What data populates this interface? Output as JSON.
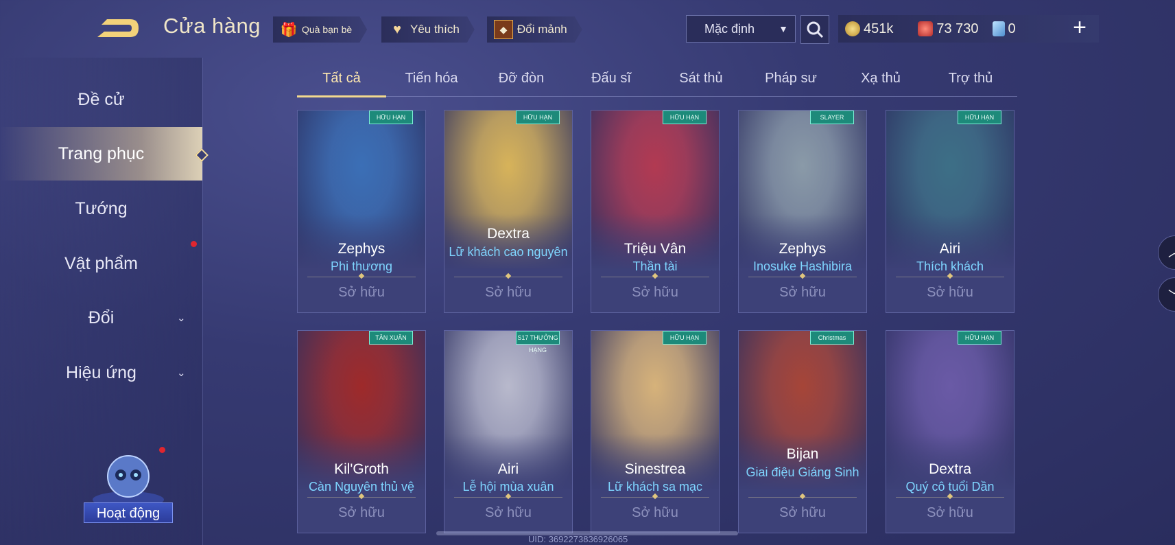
{
  "header": {
    "title": "Cửa hàng",
    "gift_label": "Quà bạn bè",
    "favorite_label": "Yêu thích",
    "exchange_label": "Đổi mảnh",
    "sort_label": "Mặc định",
    "gold": "451k",
    "voucher": "73 730",
    "gems": "0"
  },
  "sidebar": {
    "items": [
      {
        "label": "Đề cử"
      },
      {
        "label": "Trang phục"
      },
      {
        "label": "Tướng"
      },
      {
        "label": "Vật phẩm"
      },
      {
        "label": "Đổi"
      },
      {
        "label": "Hiệu ứng"
      }
    ],
    "activity_label": "Hoạt động"
  },
  "tabs": [
    "Tất cả",
    "Tiến hóa",
    "Đỡ đòn",
    "Đấu sĩ",
    "Sát thủ",
    "Pháp sư",
    "Xạ thủ",
    "Trợ thủ"
  ],
  "cards": [
    {
      "hero": "Zephys",
      "skin": "Phi thương",
      "status": "Sở hữu",
      "badge": "HỮU HẠN",
      "color": "#3b6fb6"
    },
    {
      "hero": "Dextra",
      "skin": "Lữ khách cao nguyên",
      "status": "Sở hữu",
      "badge": "HỮU HẠN",
      "color": "#d7b35a"
    },
    {
      "hero": "Triệu Vân",
      "skin": "Thần tài",
      "status": "Sở hữu",
      "badge": "HỮU HẠN",
      "color": "#b23a52"
    },
    {
      "hero": "Zephys",
      "skin": "Inosuke Hashibira",
      "status": "Sở hữu",
      "badge": "SLAYER",
      "color": "#8a9aa8"
    },
    {
      "hero": "Airi",
      "skin": "Thích khách",
      "status": "Sở hữu",
      "badge": "HỮU HẠN",
      "color": "#3d6f86"
    },
    {
      "hero": "Kil'Groth",
      "skin": "Càn Nguyên thủ vệ",
      "status": "Sở hữu",
      "badge": "TÂN XUÂN",
      "color": "#9e2a2a"
    },
    {
      "hero": "Airi",
      "skin": "Lễ hội mùa xuân",
      "status": "Sở hữu",
      "badge": "S17 THƯỞNG HẠNG",
      "color": "#b8b9cc"
    },
    {
      "hero": "Sinestrea",
      "skin": "Lữ khách sa mạc",
      "status": "Sở hữu",
      "badge": "HỮU HẠN",
      "color": "#d6b27a"
    },
    {
      "hero": "Bijan",
      "skin": "Giai điệu Giáng Sinh",
      "status": "Sở hữu",
      "badge": "Christmas",
      "color": "#a64538"
    },
    {
      "hero": "Dextra",
      "skin": "Quý cô tuổi Dần",
      "status": "Sở hữu",
      "badge": "HỮU HẠN",
      "color": "#6a5aa6"
    }
  ],
  "footer": {
    "uid": "UID: 3692273836926065"
  }
}
